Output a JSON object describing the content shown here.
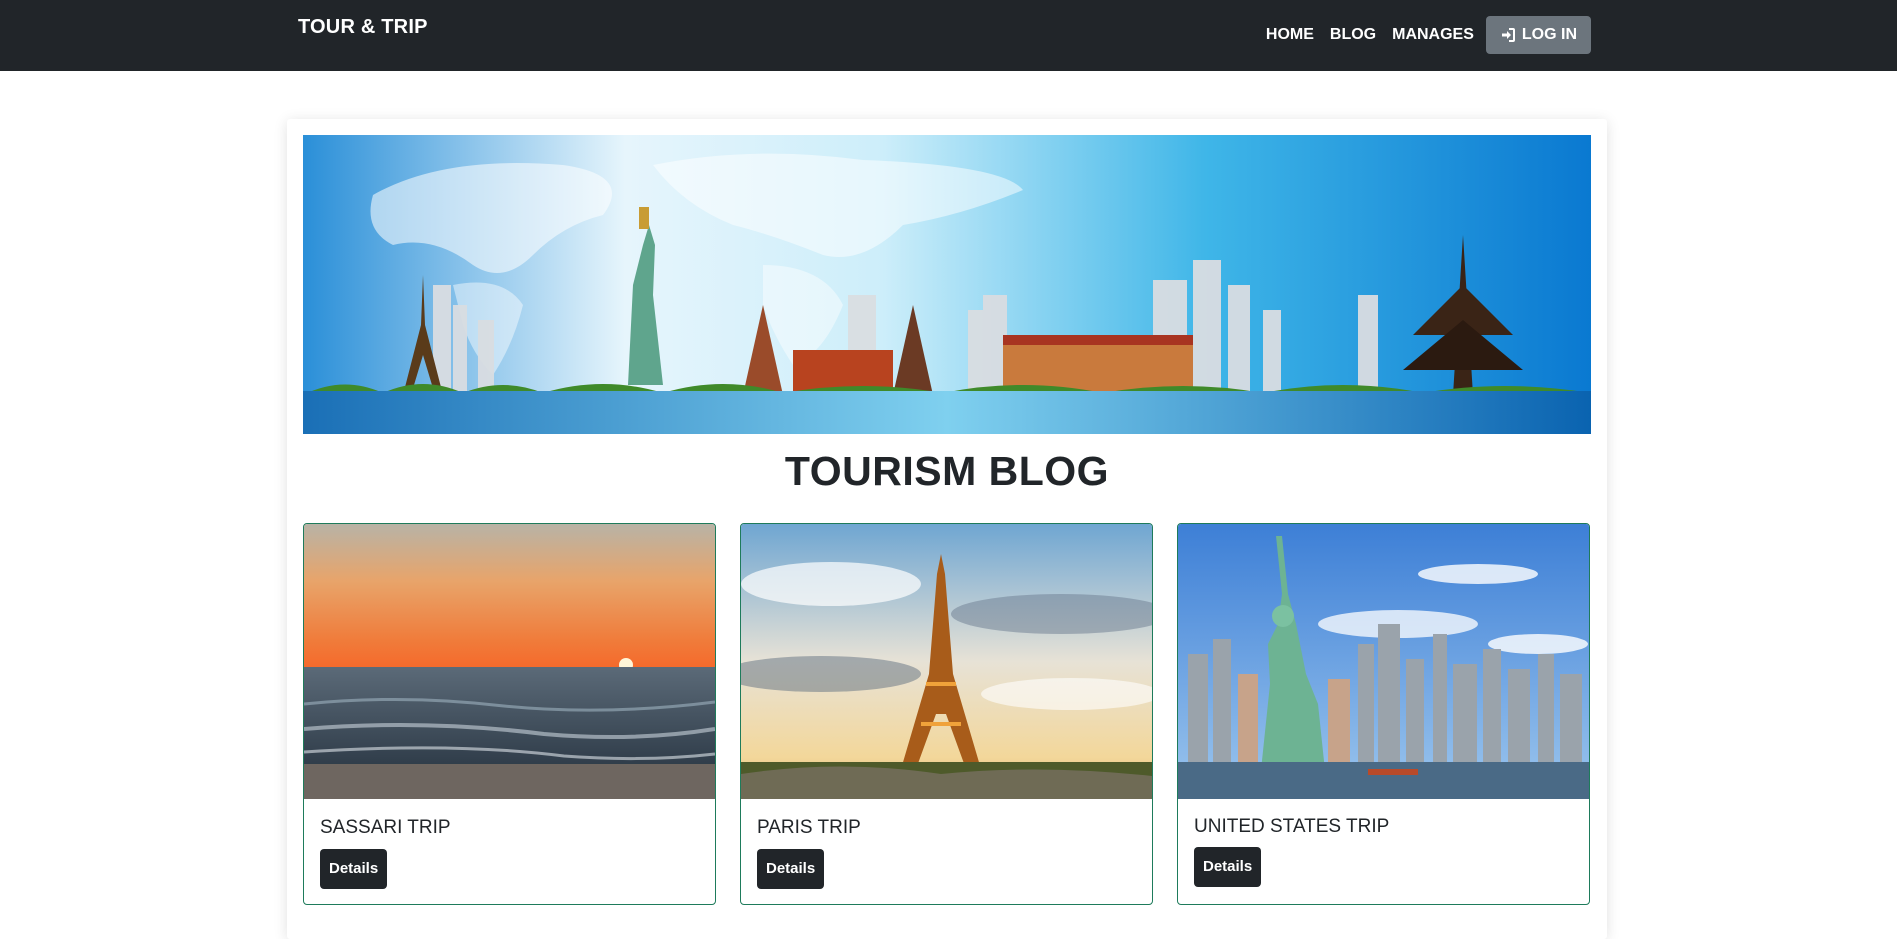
{
  "navbar": {
    "brand": "TOUR & TRIP",
    "links": [
      "HOME",
      "BLOG",
      "MANAGES"
    ],
    "login_label": "LOG IN"
  },
  "page": {
    "title": "TOURISM BLOG"
  },
  "trips": [
    {
      "title": "SASSARI TRIP",
      "button": "Details",
      "image": "sunset-beach"
    },
    {
      "title": "PARIS TRIP",
      "button": "Details",
      "image": "eiffel-tower"
    },
    {
      "title": "UNITED STATES TRIP",
      "button": "Details",
      "image": "statue-of-liberty"
    }
  ],
  "colors": {
    "navbar_bg": "#212529",
    "login_bg": "#6c757d",
    "card_border": "#1e7b5b",
    "button_bg": "#212529"
  }
}
